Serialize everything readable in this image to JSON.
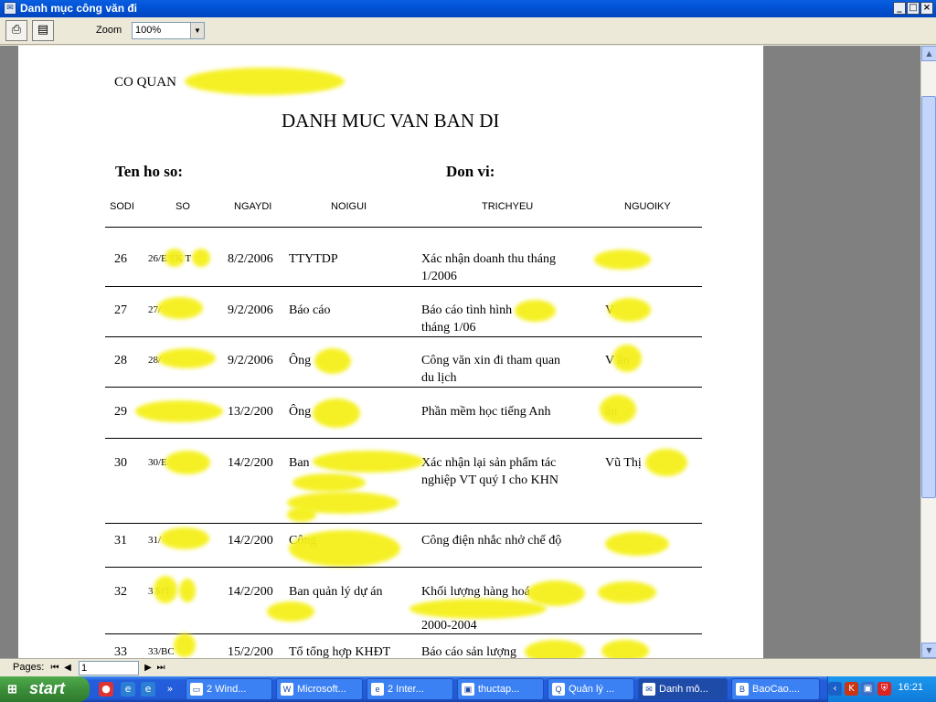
{
  "window": {
    "title": "Danh mục công văn đi"
  },
  "toolbar": {
    "zoom_label": "Zoom",
    "zoom_value": "100%"
  },
  "report": {
    "agency_label": "CO QUAN",
    "title": "DANH MUC VAN BAN DI",
    "ten_ho_so_label": "Ten ho so:",
    "don_vi_label": "Don vi:",
    "columns": [
      "SODI",
      "SO",
      "NGAYDI",
      "NOIGUI",
      "TRICHYEU",
      "NGUOIKY"
    ],
    "rows": [
      {
        "sodi": "26",
        "so": "26/E   TK   T",
        "ngaydi": "8/2/2006",
        "noigui": "TTYTDP",
        "trichyeu": [
          "Xác nhận doanh thu tháng",
          "1/2006"
        ],
        "nguoiky": ""
      },
      {
        "sodi": "27",
        "so": "27/",
        "ngaydi": "9/2/2006",
        "noigui": "Báo cáo",
        "trichyeu": [
          "Báo cáo tình hình",
          "tháng 1/06"
        ],
        "nguoiky": "V"
      },
      {
        "sodi": "28",
        "so": "28/",
        "ngaydi": "9/2/2006",
        "noigui": "Ông",
        "trichyeu": [
          "Công văn xin đi tham quan",
          "du lịch"
        ],
        "nguoiky": "V      ân"
      },
      {
        "sodi": "29",
        "so": "",
        "ngaydi": "13/2/200",
        "noigui": "Ông",
        "trichyeu": [
          "Phần mềm học tiếng Anh"
        ],
        "nguoiky": "      ân"
      },
      {
        "sodi": "30",
        "so": "30/E",
        "ngaydi": "14/2/200",
        "noigui": "Ban",
        "trichyeu": [
          "Xác nhận lại sản phẩm tác",
          "nghiệp VT quý I cho KHN"
        ],
        "nguoiky": "Vũ Thị"
      },
      {
        "sodi": "31",
        "so": "31/",
        "ngaydi": "14/2/200",
        "noigui": "Công",
        "trichyeu": [
          "Công điện nhắc nhở chế độ"
        ],
        "nguoiky": ""
      },
      {
        "sodi": "32",
        "so": "3      MT",
        "ngaydi": "14/2/200",
        "noigui": "Ban quản lý dự án",
        "trichyeu": [
          "Khối lượng hàng hoá",
          "",
          "2000-2004"
        ],
        "nguoiky": ""
      },
      {
        "sodi": "33",
        "so": "33/BC",
        "ngaydi": "15/2/200",
        "noigui": "Tổ tổng hợp KHĐT",
        "trichyeu": [
          "Báo cáo sản lượng"
        ],
        "nguoiky": ""
      }
    ]
  },
  "pagesbar": {
    "label": "Pages:",
    "page_value": "1"
  },
  "taskbar": {
    "start_label": "start",
    "tasks": [
      "2 Wind...",
      "Microsoft...",
      "2 Inter...",
      "thuctap...",
      "Quản lý ...",
      "Danh mô...",
      "BaoCao...."
    ],
    "clock": "16:21"
  }
}
